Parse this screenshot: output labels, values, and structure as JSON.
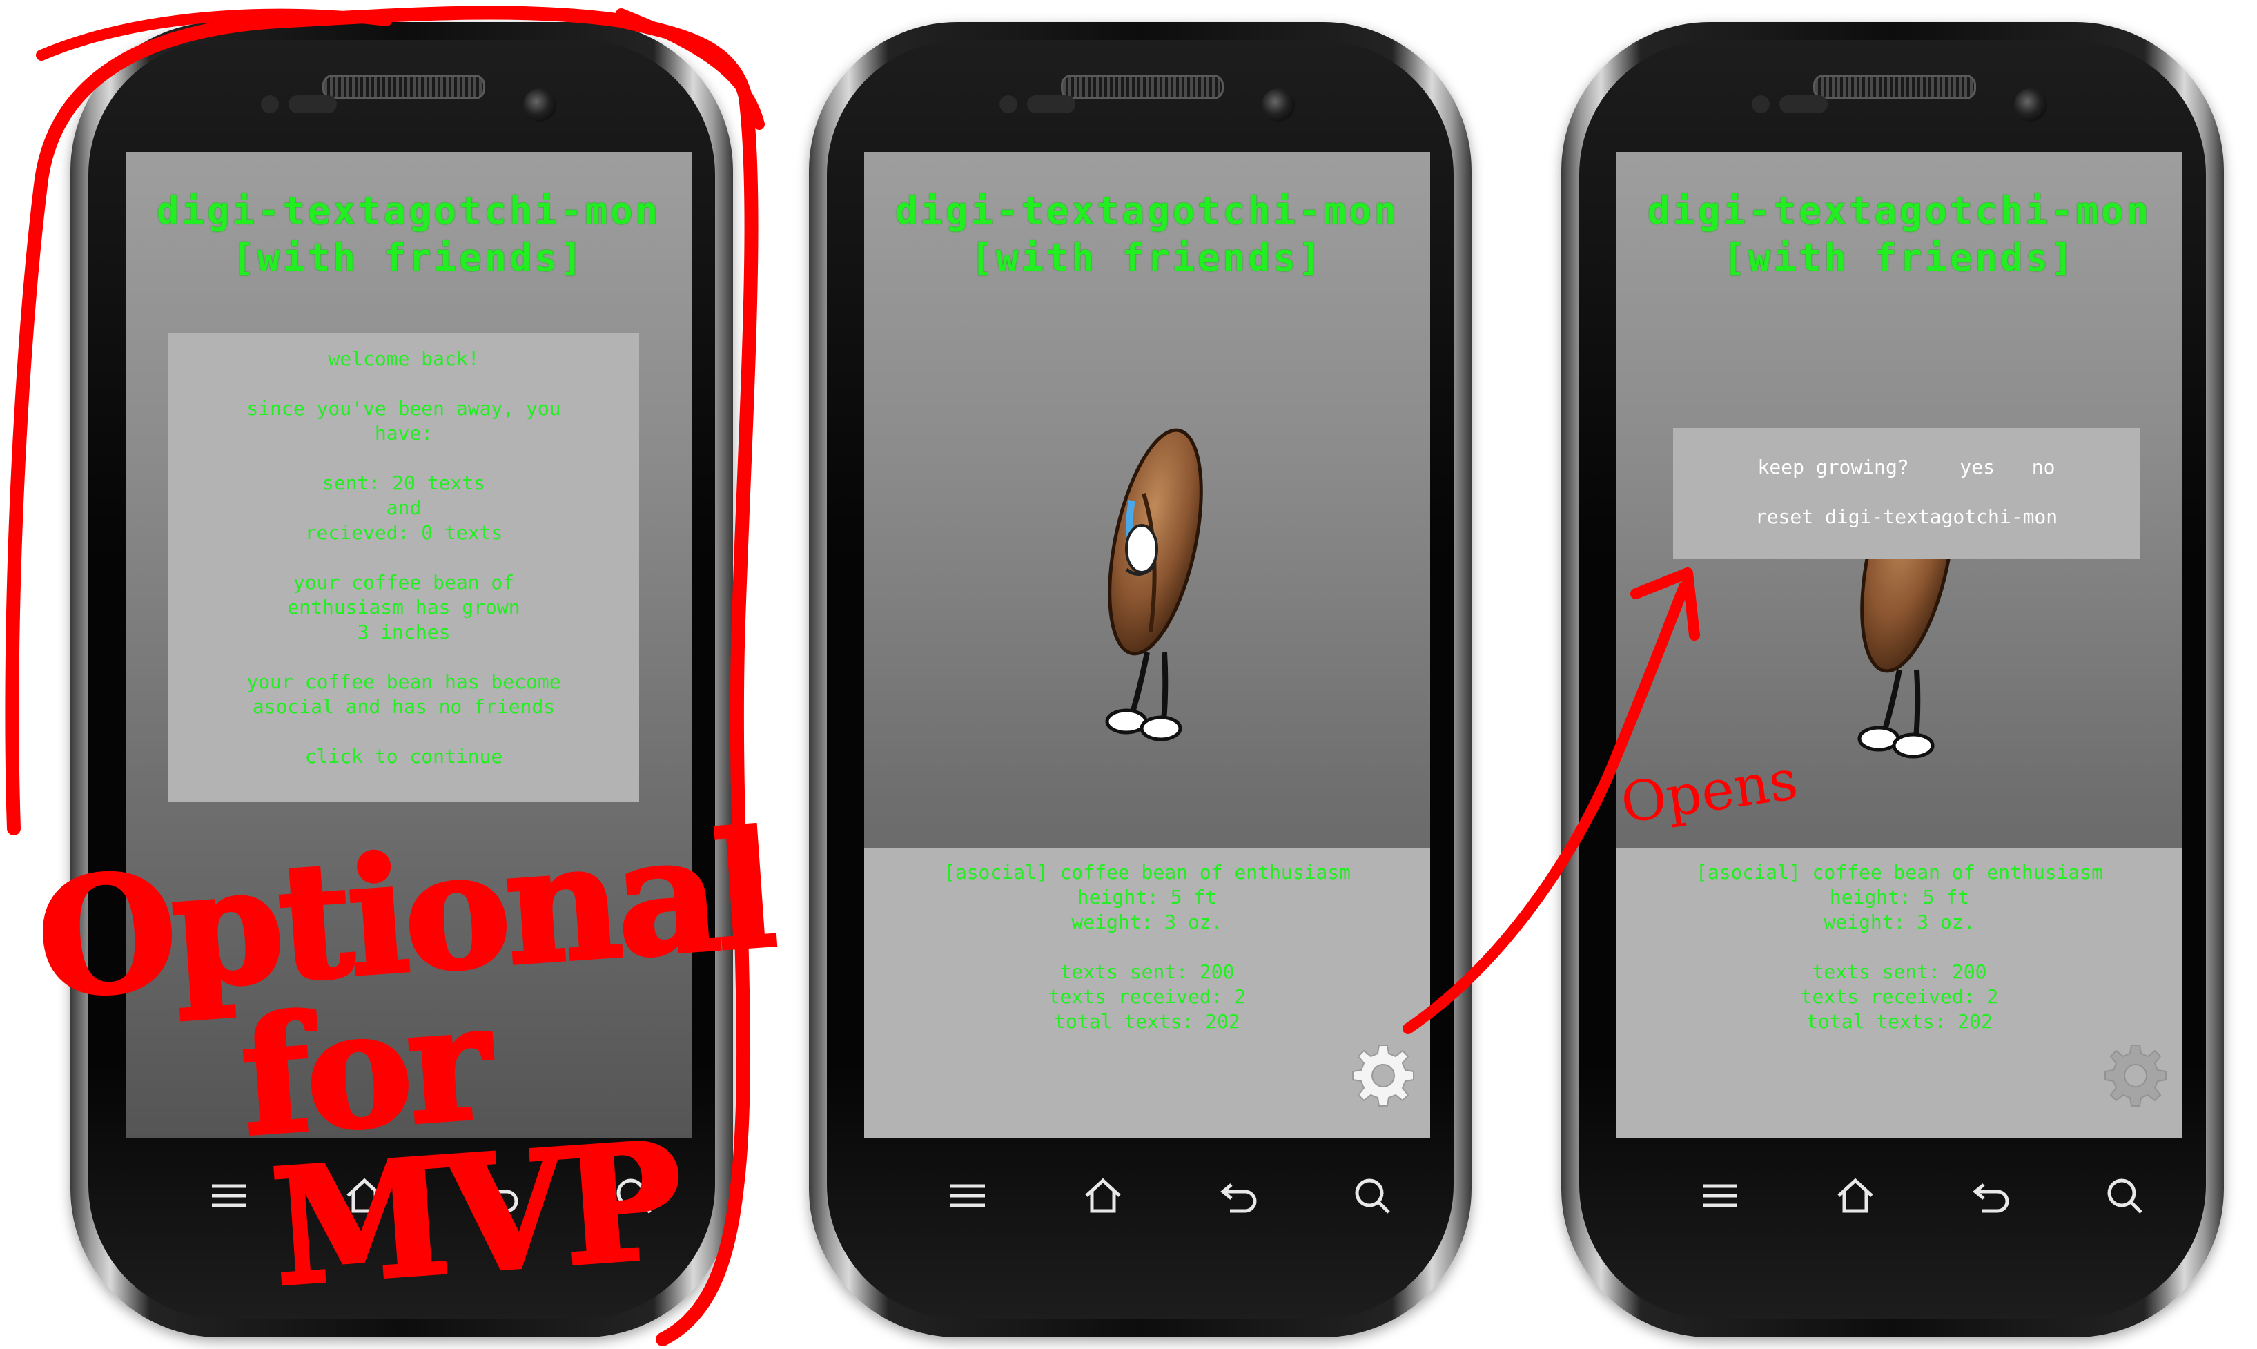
{
  "app_title": "digi-textagotchi-mon\n[with friends]",
  "screens": [
    {
      "welcome": {
        "lines": [
          "welcome back!",
          "since you've been away, you\nhave:",
          "sent: 20 texts\nand\nrecieved: 0 texts",
          "your coffee bean of\nenthusiasm has grown\n3 inches",
          "your coffee bean has become\nasocial and has no friends",
          "click to continue"
        ]
      }
    },
    {
      "stats": {
        "name": "[asocial] coffee bean of enthusiasm",
        "height": "height: 5 ft",
        "weight": "weight: 3 oz.",
        "sent": "texts sent: 200",
        "received": "texts received: 2",
        "total": "total texts: 202"
      }
    },
    {
      "popup": {
        "question": "keep growing?",
        "yes": "yes",
        "no": "no",
        "reset": "reset digi-textagotchi-mon"
      },
      "stats": {
        "name": "[asocial] coffee bean of enthusiasm",
        "height": "height: 5 ft",
        "weight": "weight: 3 oz.",
        "sent": "texts sent: 200",
        "received": "texts received: 2",
        "total": "total texts: 202"
      }
    }
  ],
  "annotations": {
    "optional_line1": "Optional",
    "optional_line2": "for",
    "optional_line3": "MVP",
    "opens": "Opens"
  },
  "icons": {
    "nav": [
      "menu-icon",
      "home-icon",
      "back-icon",
      "search-icon"
    ],
    "settings": "gear-icon"
  },
  "colors": {
    "accent_green": "#22ee22",
    "annotation_red": "#ff0000",
    "card_gray": "#b3b3b3"
  }
}
